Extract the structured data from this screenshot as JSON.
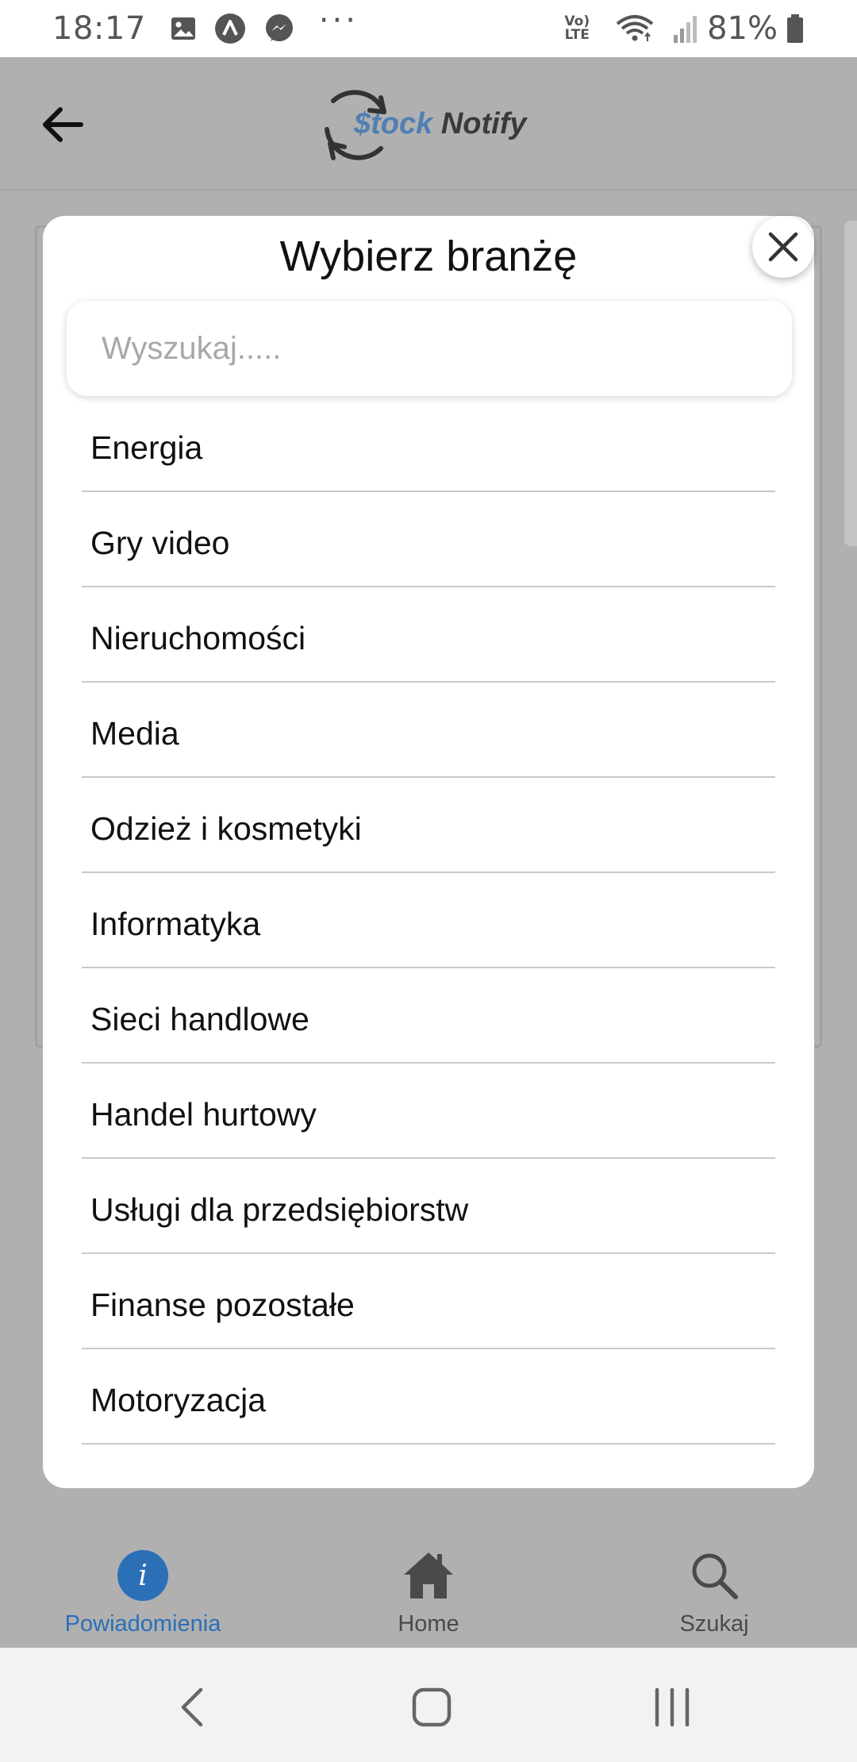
{
  "status_bar": {
    "time": "18:17",
    "network": "Vo) LTE",
    "battery_percent": "81%",
    "more": "···"
  },
  "header": {
    "logo_stock": "$tock",
    "logo_notify": "Notify",
    "accent_color": "#4f7fb3"
  },
  "modal": {
    "title": "Wybierz branżę",
    "search_placeholder": "Wyszukaj.....",
    "search_value": "",
    "items": [
      {
        "label": "Energia"
      },
      {
        "label": "Gry video"
      },
      {
        "label": "Nieruchomości"
      },
      {
        "label": "Media"
      },
      {
        "label": "Odzież i kosmetyki"
      },
      {
        "label": "Informatyka"
      },
      {
        "label": "Sieci handlowe"
      },
      {
        "label": "Handel hurtowy"
      },
      {
        "label": "Usługi dla przedsiębiorstw"
      },
      {
        "label": "Finanse pozostałe"
      },
      {
        "label": "Motoryzacja"
      }
    ]
  },
  "bottom_nav": {
    "active_color": "#2b6fb7",
    "items": [
      {
        "label": "Powiadomienia",
        "icon": "info-icon",
        "active": true
      },
      {
        "label": "Home",
        "icon": "home-icon",
        "active": false
      },
      {
        "label": "Szukaj",
        "icon": "search-icon",
        "active": false
      }
    ]
  }
}
